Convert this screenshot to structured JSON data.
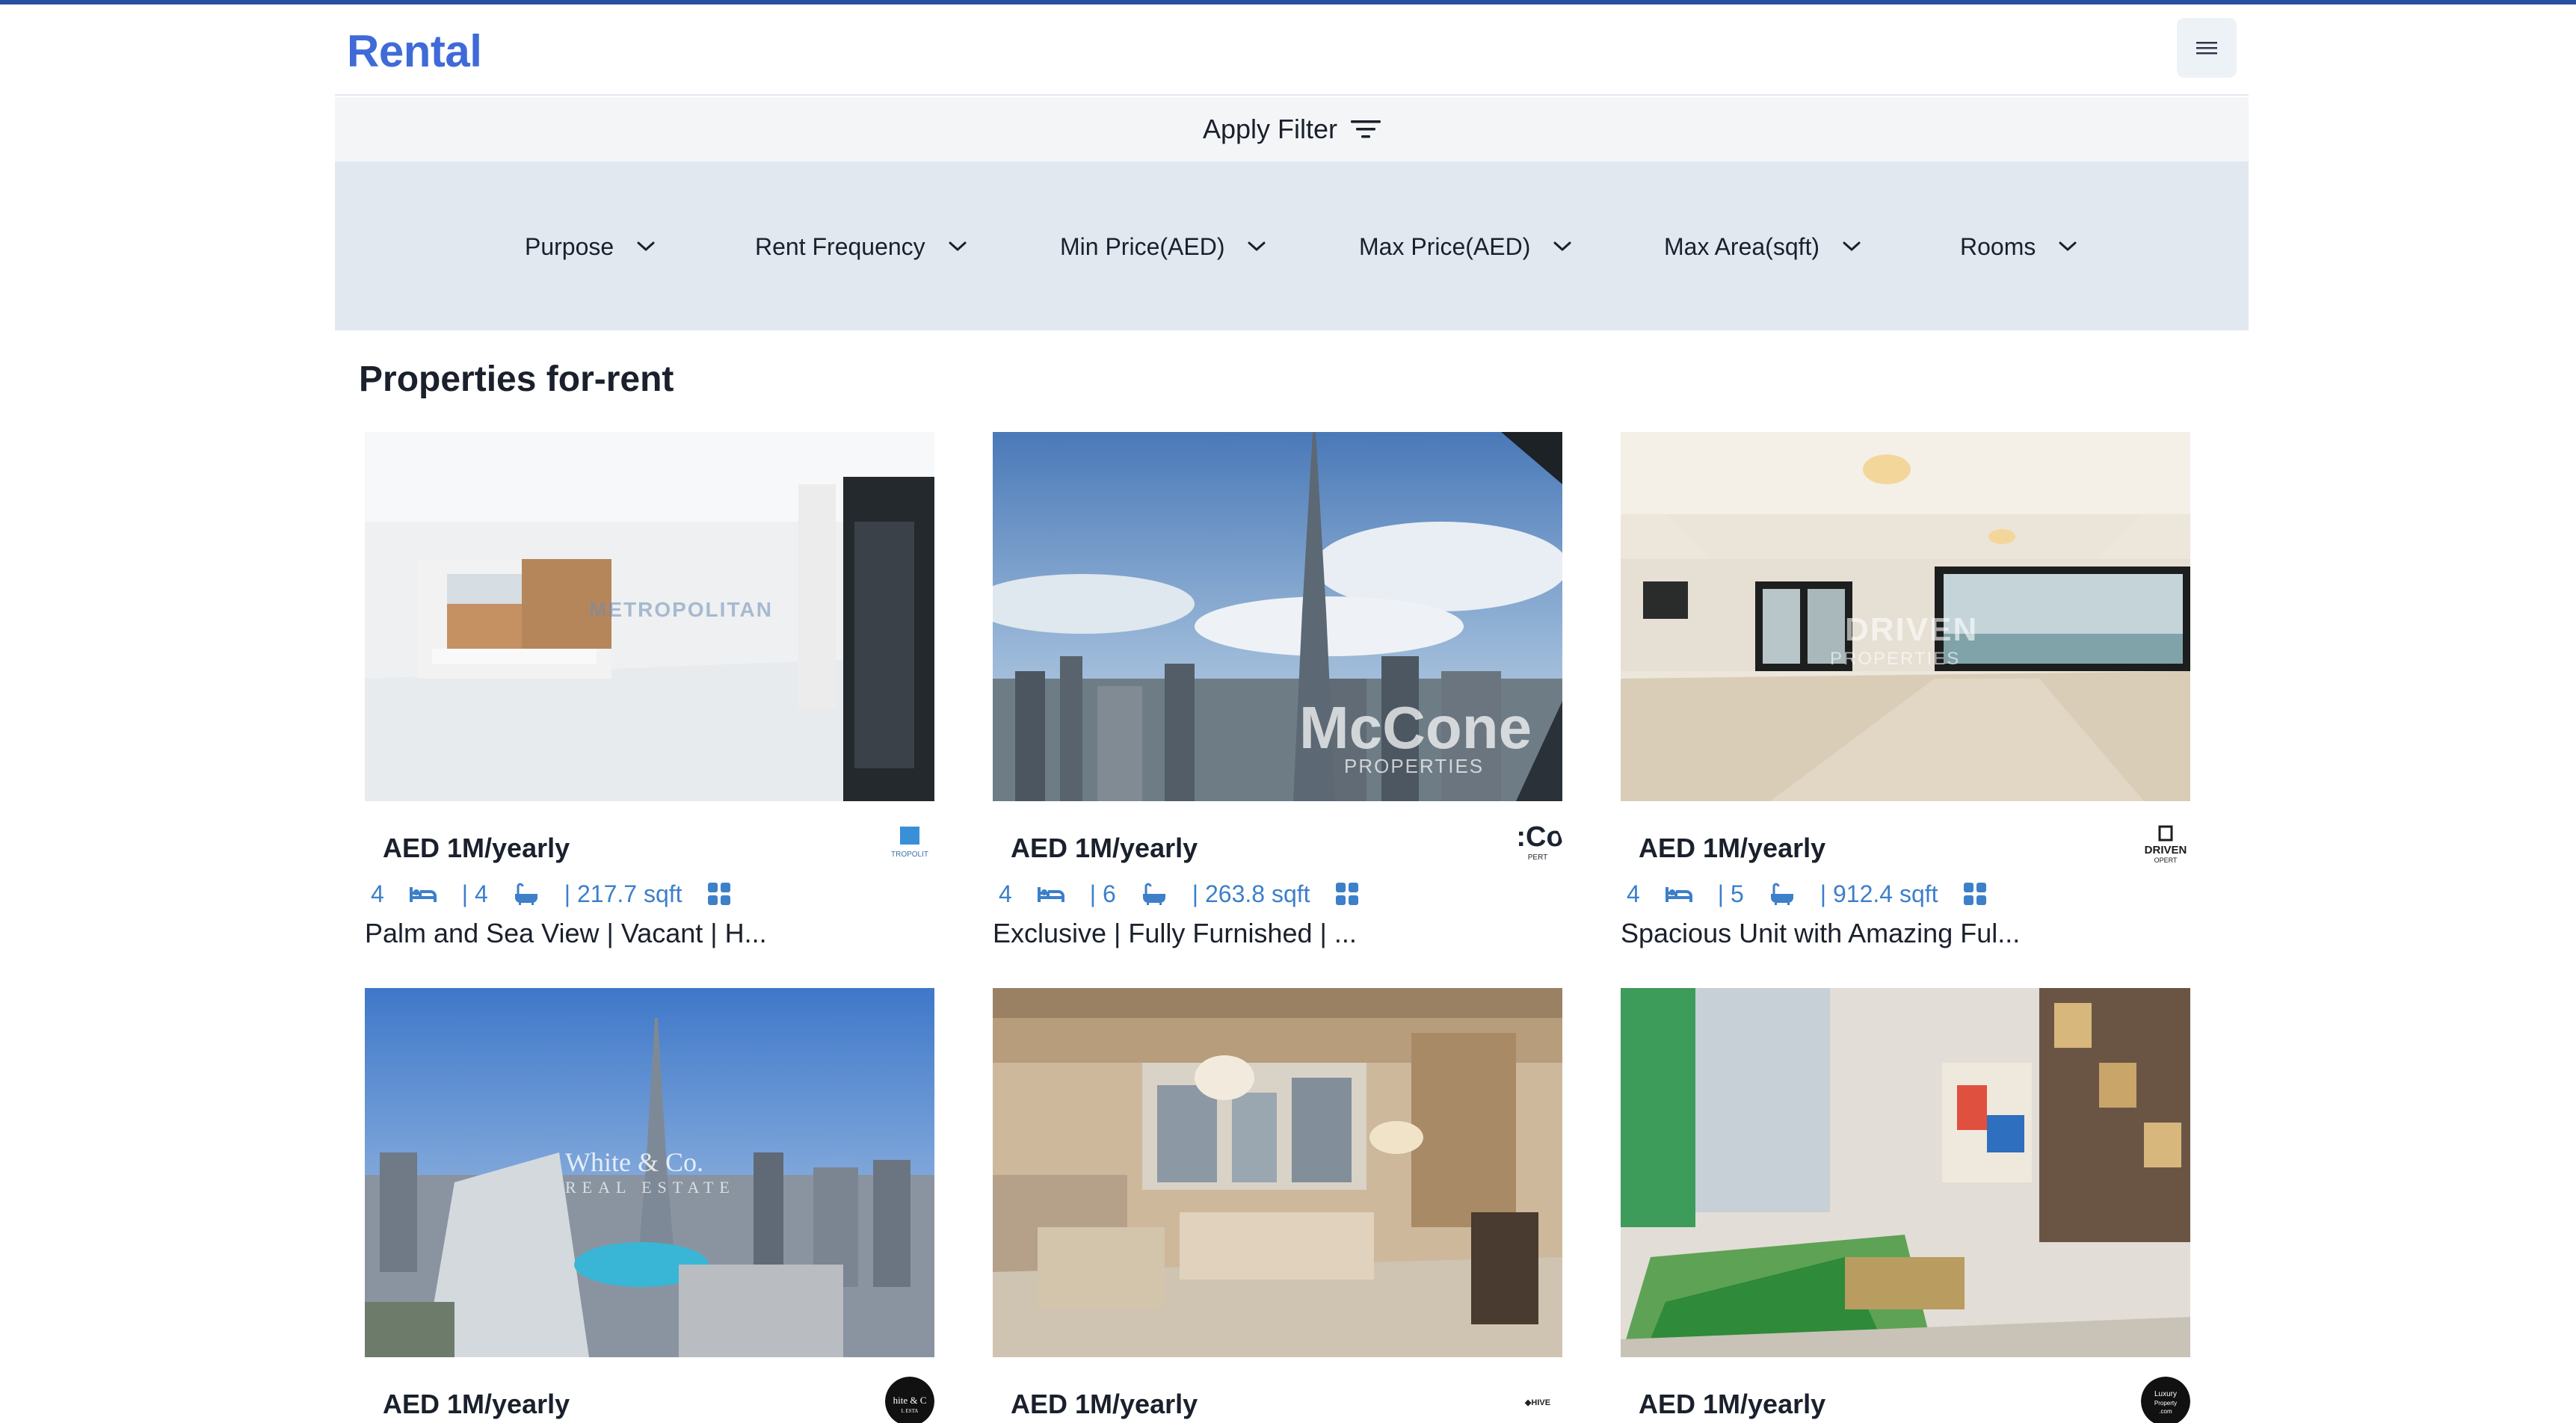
{
  "navbar": {
    "brand": "Rental",
    "menu_icon": "hamburger-menu-icon"
  },
  "filter": {
    "heading": "Apply Filter",
    "heading_icon": "filter-lines-icon",
    "selects": [
      {
        "name": "purpose",
        "label": "Purpose"
      },
      {
        "name": "rent-frequency",
        "label": "Rent Frequency"
      },
      {
        "name": "min-price",
        "label": "Min Price(AED)"
      },
      {
        "name": "max-price",
        "label": "Max Price(AED)"
      },
      {
        "name": "max-area",
        "label": "Max Area(sqft)"
      },
      {
        "name": "rooms",
        "label": "Rooms"
      }
    ]
  },
  "section": {
    "title": "Properties for-rent"
  },
  "colors": {
    "brand": "#3f6bd8",
    "stats": "#3d7fc9",
    "filter_bg": "#e2e8f0",
    "top_line": "#2b4fa0"
  },
  "properties": [
    {
      "price": "AED 1M/yearly",
      "rooms": "4",
      "baths": "| 4",
      "area": "| 217.7 sqft",
      "title": "Palm and Sea View | Vacant | H...",
      "photo_watermark": "METROPOLITAN",
      "agency_logo": "metropolitan-logo"
    },
    {
      "price": "AED 1M/yearly",
      "rooms": "4",
      "baths": "| 6",
      "area": "| 263.8 sqft",
      "title": "Exclusive | Fully Furnished | ...",
      "photo_watermark": "McCone",
      "photo_watermark_sub": "PROPERTIES",
      "agency_logo": "mccone-logo"
    },
    {
      "price": "AED 1M/yearly",
      "rooms": "4",
      "baths": "| 5",
      "area": "| 912.4 sqft",
      "title": "Spacious Unit with Amazing Ful...",
      "photo_watermark": "DRIVEN",
      "photo_watermark_sub": "PROPERTIES",
      "agency_logo": "driven-logo"
    },
    {
      "price": "AED 1M/yearly",
      "photo_watermark": "White & Co.",
      "photo_watermark_sub": "REAL ESTATE",
      "agency_logo": "white-and-co-logo"
    },
    {
      "price": "AED 1M/yearly",
      "agency_logo": "hive-logo"
    },
    {
      "price": "AED 1M/yearly",
      "agency_logo": "luxury-property-logo"
    }
  ]
}
